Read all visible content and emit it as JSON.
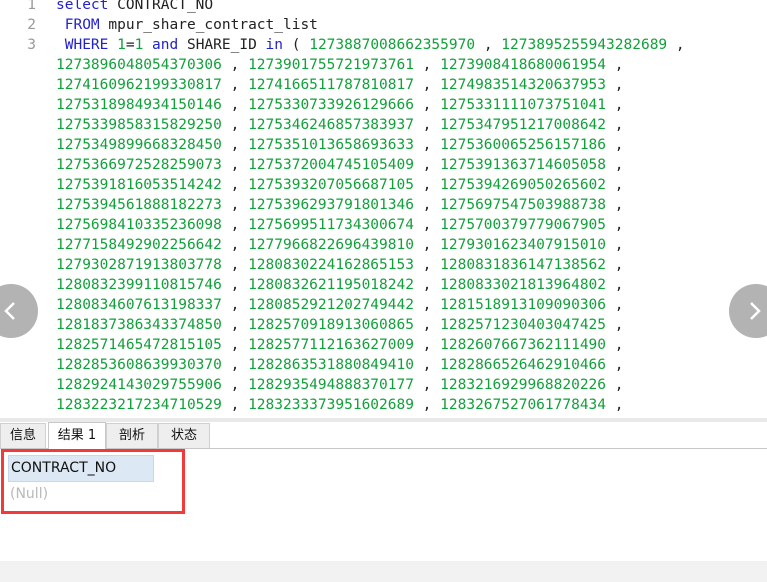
{
  "editor": {
    "lines": [
      {
        "no": "1",
        "parts": [
          {
            "t": "select ",
            "c": "kw"
          },
          {
            "t": "CONTRACT_NO",
            "c": "id"
          }
        ]
      },
      {
        "no": "2",
        "parts": [
          {
            "t": " FROM ",
            "c": "kw"
          },
          {
            "t": "mpur_share_contract_list",
            "c": "id"
          }
        ]
      },
      {
        "no": "3",
        "parts": [
          {
            "t": " WHERE ",
            "c": "kw"
          },
          {
            "t": "1",
            "c": "num"
          },
          {
            "t": "=",
            "c": "pn"
          },
          {
            "t": "1",
            "c": "num"
          },
          {
            "t": " and ",
            "c": "kw"
          },
          {
            "t": "SHARE_ID ",
            "c": "id"
          },
          {
            "t": "in",
            "c": "kw"
          },
          {
            "t": " ( ",
            "c": "pn"
          },
          {
            "t": "1273887008662355970",
            "c": "num"
          },
          {
            "t": " , ",
            "c": "pn"
          },
          {
            "t": "1273895255943282689",
            "c": "num"
          },
          {
            "t": " ,",
            "c": "pn"
          }
        ]
      },
      {
        "no": "",
        "nums": [
          "1273896048054370306",
          "1273901755721973761",
          "1273908418680061954"
        ]
      },
      {
        "no": "",
        "nums": [
          "1274160962199330817",
          "1274166511787810817",
          "1274983514320637953"
        ]
      },
      {
        "no": "",
        "nums": [
          "1275318984934150146",
          "1275330733926129666",
          "1275331111073751041"
        ]
      },
      {
        "no": "",
        "nums": [
          "1275339858315829250",
          "1275346246857383937",
          "1275347951217008642"
        ]
      },
      {
        "no": "",
        "nums": [
          "1275349899668328450",
          "1275351013658693633",
          "1275360065256157186"
        ]
      },
      {
        "no": "",
        "nums": [
          "1275366972528259073",
          "1275372004745105409",
          "1275391363714605058"
        ]
      },
      {
        "no": "",
        "nums": [
          "1275391816053514242",
          "1275393207056687105",
          "1275394269050265602"
        ]
      },
      {
        "no": "",
        "nums": [
          "1275394561888182273",
          "1275396293791801346",
          "1275697547503988738"
        ]
      },
      {
        "no": "",
        "nums": [
          "1275698410335236098",
          "1275699511734300674",
          "1275700379779067905"
        ]
      },
      {
        "no": "",
        "nums": [
          "1277158492902256642",
          "1277966822696439810",
          "1279301623407915010"
        ]
      },
      {
        "no": "",
        "nums": [
          "1279302871913803778",
          "1280830224162865153",
          "1280831836147138562"
        ]
      },
      {
        "no": "",
        "nums": [
          "1280832399110815746",
          "1280832621195018242",
          "1280833021813964802"
        ]
      },
      {
        "no": "",
        "nums": [
          "1280834607613198337",
          "1280852921202749442",
          "1281518913109090306"
        ]
      },
      {
        "no": "",
        "nums": [
          "1281837386343374850",
          "1282570918913060865",
          "1282571230403047425"
        ]
      },
      {
        "no": "",
        "nums": [
          "1282571465472815105",
          "1282577112163627009",
          "1282607667362111490"
        ]
      },
      {
        "no": "",
        "nums": [
          "1282853608639930370",
          "1282863531880849410",
          "1282866526462910466"
        ]
      },
      {
        "no": "",
        "nums": [
          "1282924143029755906",
          "1282935494888370177",
          "1283216929968820226"
        ]
      },
      {
        "no": "",
        "nums": [
          "1283223217234710529",
          "1283233373951602689",
          "1283267527061778434"
        ]
      },
      {
        "no": "",
        "nums": []
      }
    ]
  },
  "nav": {
    "left_icon": "chevron-left-icon",
    "right_icon": "chevron-right-icon"
  },
  "tabs": [
    {
      "label": "信息",
      "active": false
    },
    {
      "label": "结果 1",
      "active": true
    },
    {
      "label": "剖析",
      "active": false
    },
    {
      "label": "状态",
      "active": false
    }
  ],
  "result": {
    "column": "CONTRACT_NO",
    "cell": "(Null)"
  },
  "colors": {
    "keyword": "#2222cc",
    "number": "#11a13a",
    "highlight_box": "#f23a3a"
  }
}
